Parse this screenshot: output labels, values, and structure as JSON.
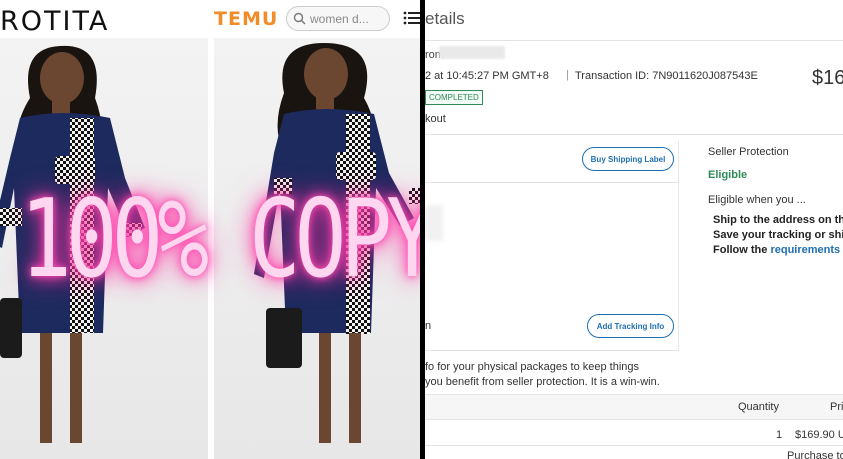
{
  "left_panel": {
    "brand_left": "ROTITA",
    "brand_right": "TEMU",
    "search": {
      "value": "women d...",
      "icon": "search-icon"
    },
    "menu_icon": "menu-icon",
    "overlay_text": "100% COPY",
    "colors": {
      "temu_orange": "#f28c28",
      "neon_pink": "#ff3aa8",
      "dress_navy": "#1d2a5e"
    }
  },
  "right_panel": {
    "title": "etails",
    "from_label": "rom",
    "timestamp": "2 at 10:45:27 PM GMT+8",
    "separator": "|",
    "transaction_id": "Transaction ID: 7N9011620J087543E",
    "amount": "$16",
    "status_badge": "COMPLETED",
    "checkout": "kout",
    "buy_shipping_label": "Buy Shipping Label",
    "n_label": "n",
    "add_tracking_info": "Add Tracking Info",
    "info_line1": "fo for your physical packages to keep things",
    "info_line2": "you benefit from seller protection. It is a win-win.",
    "seller_protection": {
      "title": "Seller Protection",
      "status": "Eligible",
      "eligible_when": "Eligible when you ...",
      "item1": "Ship to the address on this p",
      "item2": "Save your tracking or shippi",
      "item3_prefix": "Follow the ",
      "item3_link": "requirements for"
    },
    "table": {
      "col_quantity": "Quantity",
      "col_price": "Pri",
      "row_quantity": "1",
      "row_price": "$169.90 U",
      "purchase_label": "Purchase to"
    },
    "colors": {
      "green": "#2e8b57",
      "link_blue": "#1f6fb0"
    }
  }
}
